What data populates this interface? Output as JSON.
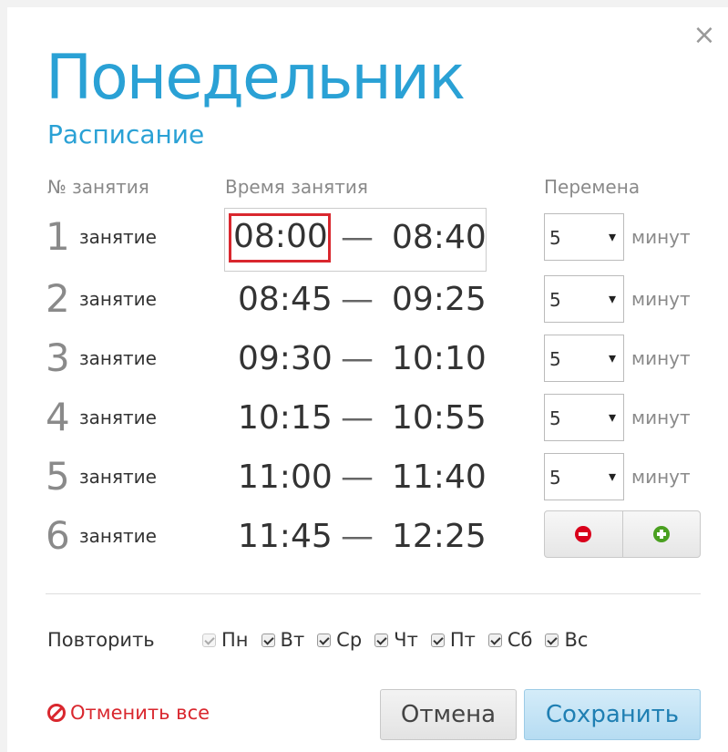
{
  "dialog": {
    "title": "Понедельник",
    "subtitle": "Расписание",
    "close_glyph": "×"
  },
  "columns": {
    "lesson_no": "№ занятия",
    "time": "Время занятия",
    "break": "Перемена"
  },
  "lessons": [
    {
      "num": "1",
      "word": "занятие",
      "start": "08:00",
      "dash": "—",
      "end": "08:40",
      "break_value": "5",
      "break_unit": "минут"
    },
    {
      "num": "2",
      "word": "занятие",
      "start": "08:45",
      "dash": "—",
      "end": "09:25",
      "break_value": "5",
      "break_unit": "минут"
    },
    {
      "num": "3",
      "word": "занятие",
      "start": "09:30",
      "dash": "—",
      "end": "10:10",
      "break_value": "5",
      "break_unit": "минут"
    },
    {
      "num": "4",
      "word": "занятие",
      "start": "10:15",
      "dash": "—",
      "end": "10:55",
      "break_value": "5",
      "break_unit": "минут"
    },
    {
      "num": "5",
      "word": "занятие",
      "start": "11:00",
      "dash": "—",
      "end": "11:40",
      "break_value": "5",
      "break_unit": "минут"
    },
    {
      "num": "6",
      "word": "занятие",
      "start": "11:45",
      "dash": "—",
      "end": "12:25"
    }
  ],
  "controls": {
    "remove_icon": "minus-circle-icon",
    "add_icon": "plus-circle-icon",
    "select_caret": "▾"
  },
  "repeat": {
    "label": "Повторить",
    "days": [
      {
        "label": "Пн",
        "checked": true,
        "disabled": true
      },
      {
        "label": "Вт",
        "checked": true,
        "disabled": false
      },
      {
        "label": "Ср",
        "checked": true,
        "disabled": false
      },
      {
        "label": "Чт",
        "checked": true,
        "disabled": false
      },
      {
        "label": "Пт",
        "checked": true,
        "disabled": false
      },
      {
        "label": "Сб",
        "checked": true,
        "disabled": false
      },
      {
        "label": "Вс",
        "checked": true,
        "disabled": false
      }
    ]
  },
  "footer": {
    "cancel_all": "Отменить все",
    "cancel": "Отмена",
    "save": "Сохранить"
  },
  "colors": {
    "accent": "#2aa1d5",
    "danger": "#d9272e",
    "add": "#4aa020"
  }
}
